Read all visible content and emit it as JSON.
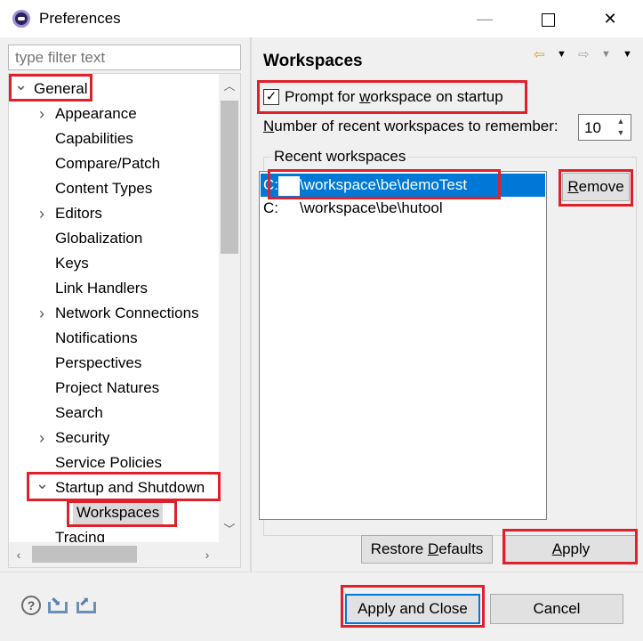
{
  "window": {
    "title": "Preferences",
    "minimize_glyph": "—",
    "close_glyph": "✕"
  },
  "left": {
    "filter_placeholder": "type filter text",
    "tree": [
      {
        "label": "General",
        "level": 0,
        "expanded": true
      },
      {
        "label": "Appearance",
        "level": 1,
        "expandable": true
      },
      {
        "label": "Capabilities",
        "level": 1
      },
      {
        "label": "Compare/Patch",
        "level": 1
      },
      {
        "label": "Content Types",
        "level": 1
      },
      {
        "label": "Editors",
        "level": 1,
        "expandable": true
      },
      {
        "label": "Globalization",
        "level": 1
      },
      {
        "label": "Keys",
        "level": 1
      },
      {
        "label": "Link Handlers",
        "level": 1
      },
      {
        "label": "Network Connections",
        "level": 1,
        "expandable": true
      },
      {
        "label": "Notifications",
        "level": 1
      },
      {
        "label": "Perspectives",
        "level": 1
      },
      {
        "label": "Project Natures",
        "level": 1
      },
      {
        "label": "Search",
        "level": 1
      },
      {
        "label": "Security",
        "level": 1,
        "expandable": true
      },
      {
        "label": "Service Policies",
        "level": 1
      },
      {
        "label": "Startup and Shutdown",
        "level": 1,
        "expanded": true
      },
      {
        "label": "Workspaces",
        "level": 2,
        "selected": true
      },
      {
        "label": "Tracing",
        "level": 1
      }
    ]
  },
  "right": {
    "title": "Workspaces",
    "prompt_checkbox": {
      "prefix": "Prompt for ",
      "mnemonic": "w",
      "suffix": "orkspace on startup",
      "checked": true
    },
    "recent_count": {
      "mnemonic": "N",
      "label_rest": "umber of recent workspaces to remember:",
      "value": "10"
    },
    "group_label": "Recent workspaces",
    "workspaces": [
      {
        "drive": "C:",
        "path": "\\workspace\\be\\demoTest",
        "selected": true
      },
      {
        "drive": "C:",
        "path": "\\workspace\\be\\hutool",
        "selected": false
      }
    ],
    "remove_button": {
      "mnemonic": "R",
      "rest": "emove"
    },
    "restore_button": {
      "prefix": "Restore ",
      "mnemonic": "D",
      "rest": "efaults"
    },
    "apply_button": {
      "mnemonic": "A",
      "rest": "pply"
    }
  },
  "bottom": {
    "apply_close_label": "Apply and Close",
    "cancel_label": "Cancel"
  },
  "colors": {
    "highlight": "#e0202a",
    "selection": "#0078d7",
    "background": "#f0f0f0"
  }
}
